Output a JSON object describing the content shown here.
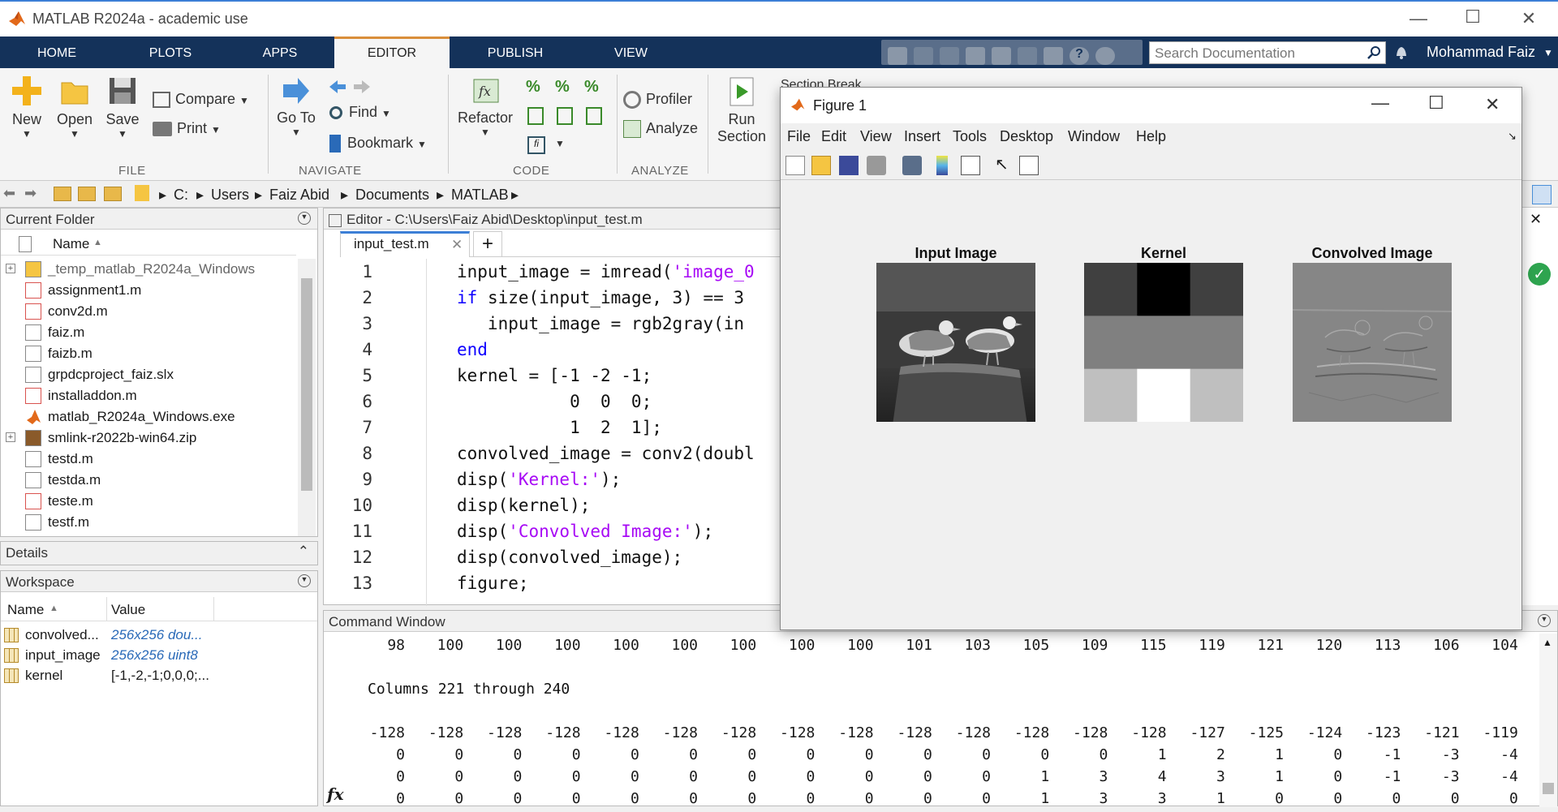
{
  "app": {
    "title": "MATLAB R2024a - academic use"
  },
  "tabs": [
    "HOME",
    "PLOTS",
    "APPS",
    "EDITOR",
    "PUBLISH",
    "VIEW"
  ],
  "active_tab": "EDITOR",
  "search": {
    "placeholder": "Search Documentation"
  },
  "user": {
    "name": "Mohammad Faiz"
  },
  "ribbon": {
    "file": {
      "new": "New",
      "open": "Open",
      "save": "Save",
      "compare": "Compare",
      "print": "Print",
      "group": "FILE"
    },
    "navigate": {
      "goto_1": "Go To",
      "find": "Find",
      "bookmark": "Bookmark",
      "group": "NAVIGATE"
    },
    "code": {
      "refactor": "Refactor",
      "group": "CODE"
    },
    "analyze": {
      "profiler": "Profiler",
      "analyze": "Analyze",
      "group": "ANALYZE"
    },
    "section": {
      "run_1": "Run",
      "run_2": "Section",
      "section_break": "Section Break"
    }
  },
  "address": {
    "crumbs": [
      "C:",
      "Users",
      "Faiz Abid",
      "Documents",
      "MATLAB"
    ]
  },
  "current_folder": {
    "title": "Current Folder",
    "column": "Name",
    "items": [
      {
        "name": "_temp_matlab_R2024a_Windows",
        "type": "folder"
      },
      {
        "name": "assignment1.m",
        "type": "func"
      },
      {
        "name": "conv2d.m",
        "type": "func"
      },
      {
        "name": "faiz.m",
        "type": "script"
      },
      {
        "name": "faizb.m",
        "type": "script"
      },
      {
        "name": "grpdcproject_faiz.slx",
        "type": "slx"
      },
      {
        "name": "installaddon.m",
        "type": "func"
      },
      {
        "name": "matlab_R2024a_Windows.exe",
        "type": "exe"
      },
      {
        "name": "smlink-r2022b-win64.zip",
        "type": "zip"
      },
      {
        "name": "testd.m",
        "type": "script"
      },
      {
        "name": "testda.m",
        "type": "script"
      },
      {
        "name": "teste.m",
        "type": "func"
      },
      {
        "name": "testf.m",
        "type": "script"
      }
    ]
  },
  "details": {
    "title": "Details"
  },
  "workspace": {
    "title": "Workspace",
    "col_name": "Name",
    "col_value": "Value",
    "vars": [
      {
        "name": "convolved...",
        "value": "256x256 dou..."
      },
      {
        "name": "input_image",
        "value": "256x256 uint8"
      },
      {
        "name": "kernel",
        "value": "[-1,-2,-1;0,0,0;..."
      }
    ]
  },
  "editor": {
    "title": "Editor - C:\\Users\\Faiz Abid\\Desktop\\input_test.m",
    "tab": "input_test.m",
    "lines": [
      {
        "n": "1",
        "pre": "input_image = imread(",
        "str": "'image_0",
        "post": ""
      },
      {
        "n": "2",
        "kw": "if",
        "pre": " size(input_image, 3) == 3",
        "str": "",
        "post": ""
      },
      {
        "n": "3",
        "pre": "   input_image = rgb2gray(in",
        "str": "",
        "post": ""
      },
      {
        "n": "4",
        "kw": "end",
        "pre": "",
        "str": "",
        "post": ""
      },
      {
        "n": "5",
        "pre": "kernel = [-1 -2 -1;",
        "str": "",
        "post": ""
      },
      {
        "n": "6",
        "pre": "           0  0  0;",
        "str": "",
        "post": ""
      },
      {
        "n": "7",
        "pre": "           1  2  1];",
        "str": "",
        "post": ""
      },
      {
        "n": "8",
        "pre": "convolved_image = conv2(doubl",
        "str": "",
        "post": ""
      },
      {
        "n": "9",
        "pre": "disp(",
        "str": "'Kernel:'",
        "post": ");"
      },
      {
        "n": "10",
        "pre": "disp(kernel);",
        "str": "",
        "post": ""
      },
      {
        "n": "11",
        "pre": "disp(",
        "str": "'Convolved Image:'",
        "post": ");"
      },
      {
        "n": "12",
        "pre": "disp(convolved_image);",
        "str": "",
        "post": ""
      },
      {
        "n": "13",
        "pre": "figure;",
        "str": "",
        "post": ""
      }
    ]
  },
  "command_window": {
    "title": "Command Window",
    "row_top": [
      "98",
      "100",
      "100",
      "100",
      "100",
      "100",
      "100",
      "100",
      "100",
      "101",
      "103",
      "105",
      "109",
      "115",
      "119",
      "121",
      "120",
      "113",
      "106",
      "104"
    ],
    "columns_label": "Columns 221 through 240",
    "rows": [
      [
        "-128",
        "-128",
        "-128",
        "-128",
        "-128",
        "-128",
        "-128",
        "-128",
        "-128",
        "-128",
        "-128",
        "-128",
        "-128",
        "-128",
        "-127",
        "-125",
        "-124",
        "-123",
        "-121",
        "-119"
      ],
      [
        "0",
        "0",
        "0",
        "0",
        "0",
        "0",
        "0",
        "0",
        "0",
        "0",
        "0",
        "0",
        "0",
        "1",
        "2",
        "1",
        "0",
        "-1",
        "-3",
        "-4"
      ],
      [
        "0",
        "0",
        "0",
        "0",
        "0",
        "0",
        "0",
        "0",
        "0",
        "0",
        "0",
        "1",
        "3",
        "4",
        "3",
        "1",
        "0",
        "-1",
        "-3",
        "-4"
      ],
      [
        "0",
        "0",
        "0",
        "0",
        "0",
        "0",
        "0",
        "0",
        "0",
        "0",
        "0",
        "1",
        "3",
        "3",
        "1",
        "0",
        "0",
        "0",
        "0",
        "0"
      ]
    ],
    "prompt": "fx"
  },
  "figure": {
    "title": "Figure 1",
    "menu": [
      "File",
      "Edit",
      "View",
      "Insert",
      "Tools",
      "Desktop",
      "Window",
      "Help"
    ],
    "axes": [
      {
        "title": "Input Image"
      },
      {
        "title": "Kernel",
        "kernel_values": [
          [
            -1,
            -2,
            -1
          ],
          [
            0,
            0,
            0
          ],
          [
            1,
            2,
            1
          ]
        ]
      },
      {
        "title": "Convolved Image"
      }
    ]
  },
  "colors": {
    "tabbar": "#14325a",
    "keyword": "#0e00ff",
    "string": "#a709f5",
    "active_tab_accent": "#d98e3a"
  }
}
